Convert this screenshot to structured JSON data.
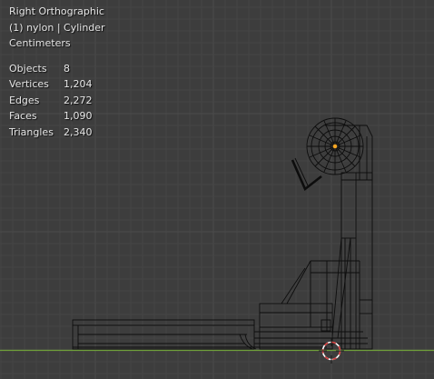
{
  "viewport": {
    "view_name": "Right Orthographic",
    "active_object": "(1) nylon | Cylinder",
    "units": "Centimeters"
  },
  "stats": [
    {
      "label": "Objects",
      "value": "8"
    },
    {
      "label": "Vertices",
      "value": "1,204"
    },
    {
      "label": "Edges",
      "value": "2,272"
    },
    {
      "label": "Faces",
      "value": "1,090"
    },
    {
      "label": "Triangles",
      "value": "2,340"
    }
  ],
  "colors": {
    "background": "#3d3d3d",
    "grid_line": "#454545",
    "grid_major": "#4c4c4c",
    "ground_axis": "#6f9f3a",
    "wire": "#0d0d0d",
    "origin_dot": "#f5a623",
    "cursor_red": "#d43c3c"
  },
  "icons": {
    "cursor": "3d-cursor-icon",
    "origin": "object-origin-icon"
  }
}
